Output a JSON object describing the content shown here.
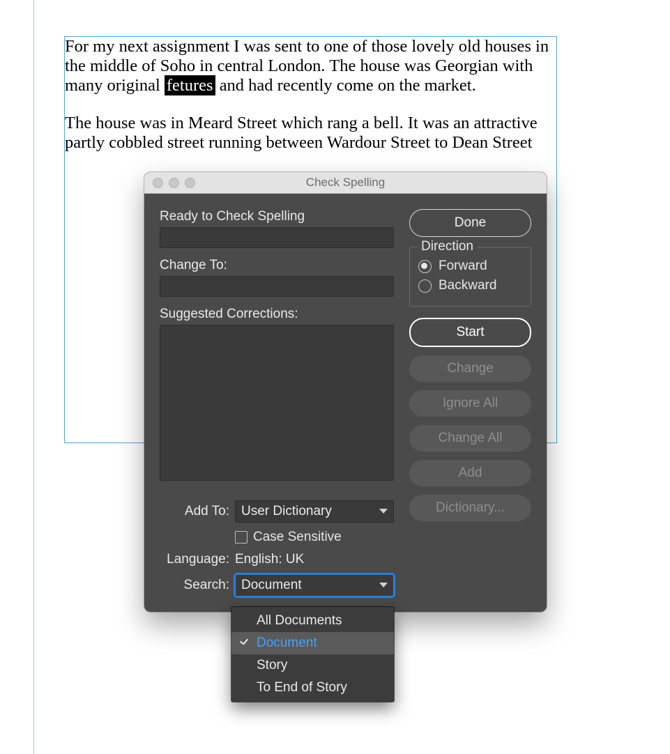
{
  "document": {
    "para1_pre": "For my next assignment I was sent to one of those lovely old houses in the middle of Soho in central London. The house was Georgian with many original ",
    "misspelled": "fetures",
    "para1_post": " and had recently come on the market.",
    "para2": "The house was in Meard Street which rang a bell. It was an attractive partly cobbled street running between Wardour Street to Dean Street"
  },
  "dialog": {
    "title": "Check Spelling",
    "status_label": "Ready to Check Spelling",
    "change_to_label": "Change To:",
    "suggested_label": "Suggested Corrections:",
    "add_to_label": "Add To:",
    "add_to_value": "User Dictionary",
    "case_sensitive_label": "Case Sensitive",
    "language_label": "Language:",
    "language_value": "English: UK",
    "search_label": "Search:",
    "search_value": "Document",
    "direction": {
      "legend": "Direction",
      "forward": "Forward",
      "backward": "Backward"
    },
    "buttons": {
      "done": "Done",
      "start": "Start",
      "change": "Change",
      "ignore_all": "Ignore All",
      "change_all": "Change All",
      "add": "Add",
      "dictionary": "Dictionary..."
    },
    "search_menu": {
      "all_documents": "All Documents",
      "document": "Document",
      "story": "Story",
      "to_end": "To End of Story"
    }
  }
}
